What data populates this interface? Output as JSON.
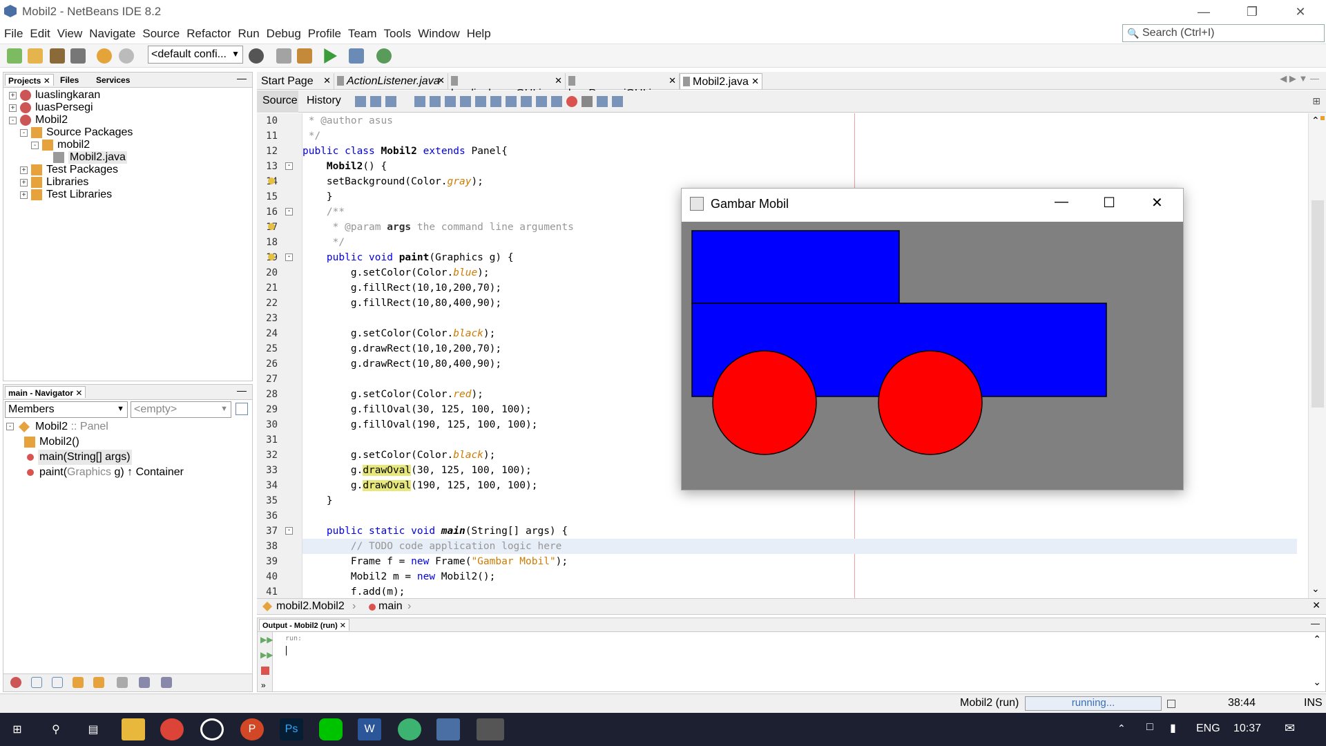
{
  "window": {
    "title": "Mobil2 - NetBeans IDE 8.2"
  },
  "menu": [
    "File",
    "Edit",
    "View",
    "Navigate",
    "Source",
    "Refactor",
    "Run",
    "Debug",
    "Profile",
    "Team",
    "Tools",
    "Window",
    "Help"
  ],
  "search": {
    "placeholder": "Search (Ctrl+I)"
  },
  "toolbar": {
    "config": "<default confi..."
  },
  "projects_panel": {
    "tabs": [
      "Projects",
      "Files",
      "Services"
    ],
    "tree": [
      {
        "label": "luaslingkaran",
        "level": 0,
        "expander": "+"
      },
      {
        "label": "luasPersegi",
        "level": 0,
        "expander": "+"
      },
      {
        "label": "Mobil2",
        "level": 0,
        "expander": "-"
      },
      {
        "label": "Source Packages",
        "level": 1,
        "expander": "-"
      },
      {
        "label": "mobil2",
        "level": 2,
        "expander": "-"
      },
      {
        "label": "Mobil2.java",
        "level": 3,
        "expander": ""
      },
      {
        "label": "Test Packages",
        "level": 1,
        "expander": "+"
      },
      {
        "label": "Libraries",
        "level": 1,
        "expander": "+"
      },
      {
        "label": "Test Libraries",
        "level": 1,
        "expander": "+"
      }
    ]
  },
  "navigator": {
    "tab": "main - Navigator",
    "members": "Members",
    "filter": "<empty>",
    "root": "Mobil2",
    "root_suffix": " :: Panel",
    "items": [
      {
        "name": "Mobil2()",
        "type": ""
      },
      {
        "name": "main(String[] args)",
        "type": ""
      },
      {
        "name": "paint(",
        "param": "Graphics",
        "rest": " g) ↑ Container"
      }
    ]
  },
  "editor_tabs": [
    {
      "label": "Start Page",
      "italic": false
    },
    {
      "label": "ActionListener.java",
      "italic": true
    },
    {
      "label": "luaslingkaranGUI.java",
      "italic": false
    },
    {
      "label": "luasPersegiGUI.java",
      "italic": false
    },
    {
      "label": "Mobil2.java",
      "italic": false
    }
  ],
  "source_tabs": {
    "source": "Source",
    "history": "History"
  },
  "code_lines": [
    {
      "n": "10",
      "t": "<span class='cm'> * @author asus</span>"
    },
    {
      "n": "11",
      "t": "<span class='cm'> */</span>"
    },
    {
      "n": "12",
      "t": "<span class='kw'>public class</span> <span class='bold'>Mobil2</span> <span class='kw'>extends</span> Panel{"
    },
    {
      "n": "13",
      "t": "    <span class='bold'>Mobil2</span>() {"
    },
    {
      "n": "14",
      "t": "    setBackground(Color.<span class='it'>gray</span>);"
    },
    {
      "n": "15",
      "t": "    }"
    },
    {
      "n": "16",
      "t": "    <span class='cm'>/**</span>"
    },
    {
      "n": "17",
      "t": "    <span class='cm'> * @param <b style='color:#333'>args</b> the command line arguments</span>"
    },
    {
      "n": "18",
      "t": "    <span class='cm'> */</span>"
    },
    {
      "n": "19",
      "t": "    <span class='kw'>public void</span> <span class='bold'>paint</span>(Graphics g) {"
    },
    {
      "n": "20",
      "t": "        g.setColor(Color.<span class='it'>blue</span>);"
    },
    {
      "n": "21",
      "t": "        g.fillRect(10,10,200,70);"
    },
    {
      "n": "22",
      "t": "        g.fillRect(10,80,400,90);"
    },
    {
      "n": "23",
      "t": ""
    },
    {
      "n": "24",
      "t": "        g.setColor(Color.<span class='it'>black</span>);"
    },
    {
      "n": "25",
      "t": "        g.drawRect(10,10,200,70);"
    },
    {
      "n": "26",
      "t": "        g.drawRect(10,80,400,90);"
    },
    {
      "n": "27",
      "t": ""
    },
    {
      "n": "28",
      "t": "        g.setColor(Color.<span class='it'>red</span>);"
    },
    {
      "n": "29",
      "t": "        g.fillOval(30, 125, 100, 100);"
    },
    {
      "n": "30",
      "t": "        g.fillOval(190, 125, 100, 100);"
    },
    {
      "n": "31",
      "t": ""
    },
    {
      "n": "32",
      "t": "        g.setColor(Color.<span class='it'>black</span>);"
    },
    {
      "n": "33",
      "t": "        g.<span class='hl'>drawOval</span>(30, 125, 100, 100);"
    },
    {
      "n": "34",
      "t": "        g.<span class='hl'>drawOval</span>(190, 125, 100, 100);"
    },
    {
      "n": "35",
      "t": "    }"
    },
    {
      "n": "36",
      "t": ""
    },
    {
      "n": "37",
      "t": "    <span class='kw'>public static void</span> <b><i>main</i></b>(String[] args) {"
    },
    {
      "n": "38",
      "t": "        <span class='cm'>// TODO code application logic here</span>"
    },
    {
      "n": "39",
      "t": "        Frame f = <span class='kw'>new</span> Frame(<span class='str'>\"Gambar Mobil\"</span>);"
    },
    {
      "n": "40",
      "t": "        Mobil2 m = <span class='kw'>new</span> Mobil2();"
    },
    {
      "n": "41",
      "t": "        f.add(m);"
    }
  ],
  "breadcrumb": {
    "cls": "mobil2.Mobil2",
    "method": "main"
  },
  "output": {
    "tab": "Output - Mobil2 (run)",
    "text": "run:"
  },
  "frame": {
    "title": "Gambar Mobil"
  },
  "status": {
    "task": "Mobil2 (run)",
    "progress": "running...",
    "position": "38:44",
    "mode": "INS"
  },
  "taskbar": {
    "lang": "ENG",
    "time": "10:37"
  }
}
